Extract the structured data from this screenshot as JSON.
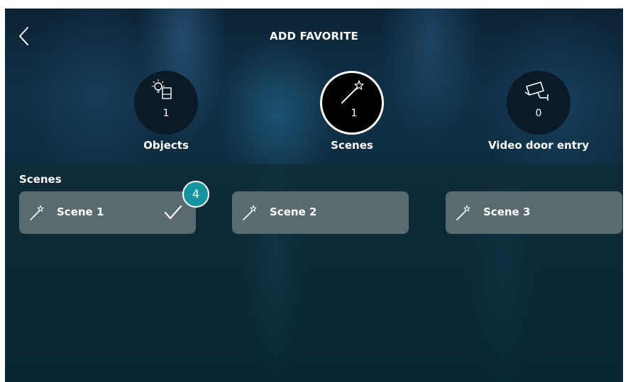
{
  "header": {
    "title": "ADD FAVORITE"
  },
  "categories": [
    {
      "id": "objects",
      "label": "Objects",
      "count": "1",
      "icon": "bulb-switch-icon",
      "active": false
    },
    {
      "id": "scenes",
      "label": "Scenes",
      "count": "1",
      "icon": "magic-wand-icon",
      "active": true
    },
    {
      "id": "video",
      "label": "Video door entry",
      "count": "0",
      "icon": "camera-icon",
      "active": false
    }
  ],
  "section": {
    "title": "Scenes"
  },
  "scenes": [
    {
      "label": "Scene 1",
      "selected": true
    },
    {
      "label": "Scene 2",
      "selected": false
    },
    {
      "label": "Scene 3",
      "selected": false
    }
  ],
  "badge": {
    "value": "4"
  },
  "colors": {
    "card": "#5a6b70",
    "badge": "#1396a0",
    "background": "#062530"
  }
}
